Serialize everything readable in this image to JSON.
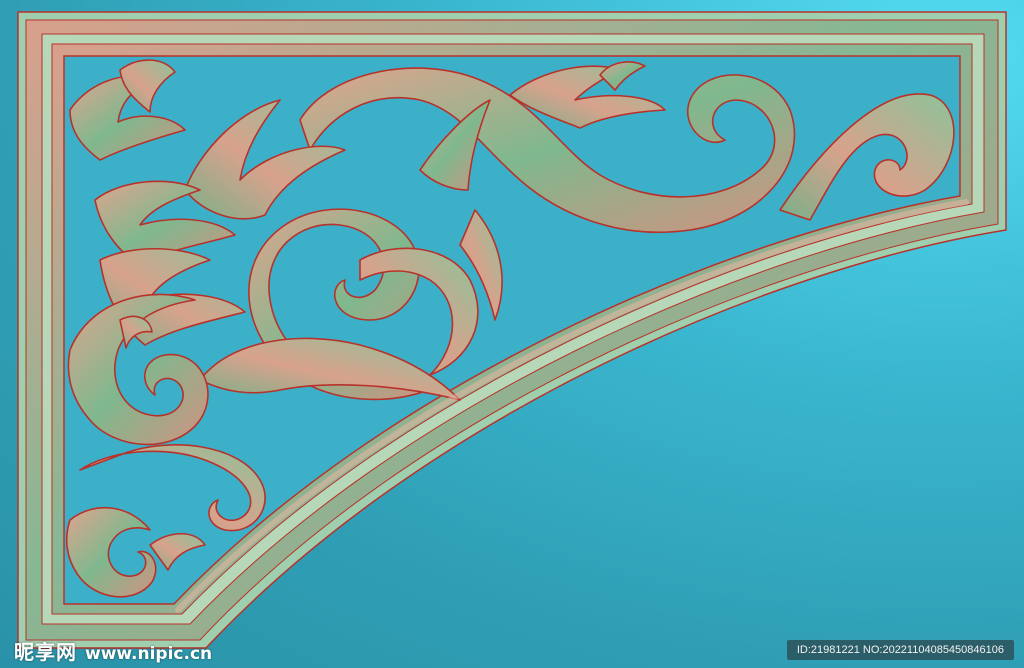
{
  "image": {
    "subject": "carved corner bracket",
    "colors": {
      "background": "#3ab6cf",
      "frame_rose": "#d49a84",
      "frame_green": "#7fb58c",
      "outline": "#b8322a"
    }
  },
  "watermark": {
    "brand": "昵享网",
    "url": "www.nipic.cn",
    "id_text": "ID:21981221 NO:20221104085450846106"
  }
}
